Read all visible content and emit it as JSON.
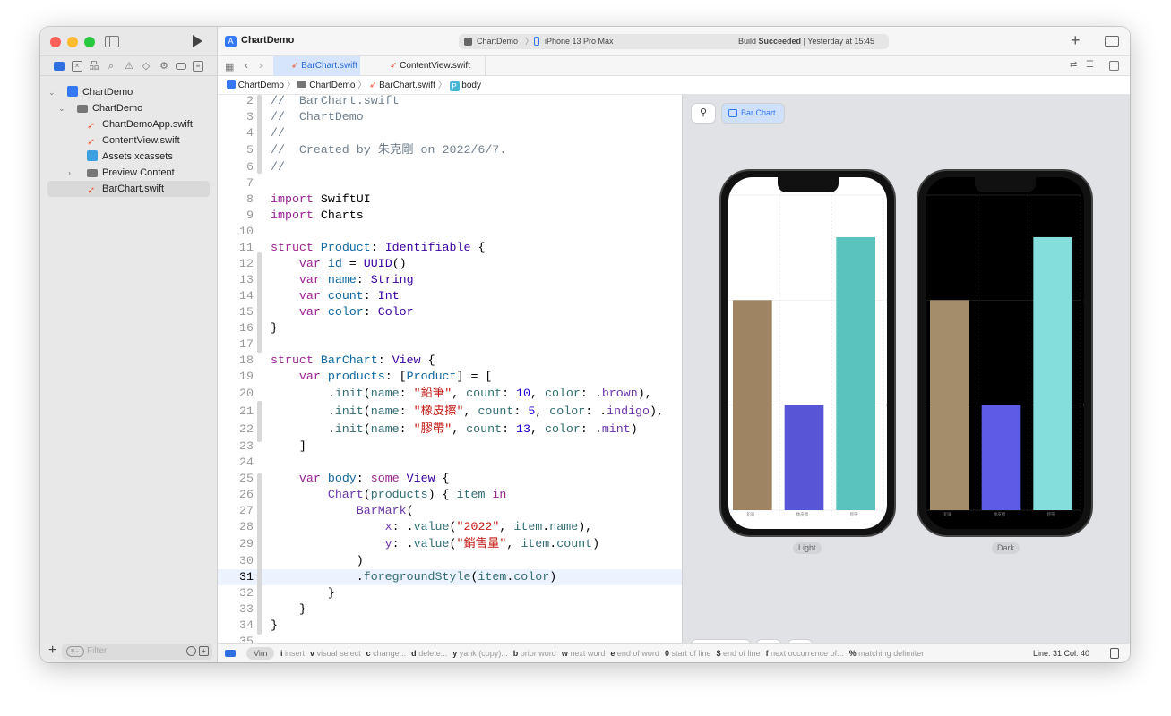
{
  "window": {
    "project": "ChartDemo",
    "scheme": "ChartDemo",
    "device": "iPhone 13 Pro Max",
    "build_status_prefix": "Build",
    "build_status": "Succeeded",
    "build_time": "| Yesterday at 15:45"
  },
  "navigator": {
    "items": [
      {
        "label": "ChartDemo",
        "kind": "project",
        "icon": "app-project-icon"
      },
      {
        "label": "ChartDemo",
        "kind": "folder",
        "icon": "folder-icon"
      },
      {
        "label": "ChartDemoApp.swift",
        "kind": "swift",
        "icon": "swift-icon"
      },
      {
        "label": "ContentView.swift",
        "kind": "swift",
        "icon": "swift-icon"
      },
      {
        "label": "Assets.xcassets",
        "kind": "assets",
        "icon": "assets-icon"
      },
      {
        "label": "Preview Content",
        "kind": "folder",
        "icon": "folder-icon"
      },
      {
        "label": "BarChart.swift",
        "kind": "swift",
        "icon": "swift-icon",
        "selected": true
      }
    ],
    "filter_placeholder": "Filter"
  },
  "tabs": [
    {
      "label": "BarChart.swift",
      "active": true
    },
    {
      "label": "ContentView.swift",
      "active": false
    }
  ],
  "breadcrumb": [
    "ChartDemo",
    "ChartDemo",
    "BarChart.swift",
    "body"
  ],
  "editor": {
    "current_line": 31,
    "lines": [
      {
        "n": 2,
        "t": [
          [
            "cm",
            "//  BarChart.swift"
          ]
        ]
      },
      {
        "n": 3,
        "t": [
          [
            "cm",
            "//  ChartDemo"
          ]
        ]
      },
      {
        "n": 4,
        "t": [
          [
            "cm",
            "//"
          ]
        ]
      },
      {
        "n": 5,
        "t": [
          [
            "cm",
            "//  Created by 朱克剛 on 2022/6/7."
          ]
        ]
      },
      {
        "n": 6,
        "t": [
          [
            "cm",
            "//"
          ]
        ]
      },
      {
        "n": 7,
        "t": []
      },
      {
        "n": 8,
        "t": [
          [
            "kw",
            "import"
          ],
          [
            "pl",
            " SwiftUI"
          ]
        ]
      },
      {
        "n": 9,
        "t": [
          [
            "kw",
            "import"
          ],
          [
            "pl",
            " Charts"
          ]
        ]
      },
      {
        "n": 10,
        "t": []
      },
      {
        "n": 11,
        "t": [
          [
            "kw",
            "struct"
          ],
          [
            "pl",
            " "
          ],
          [
            "decl",
            "Product"
          ],
          [
            "pl",
            ": "
          ],
          [
            "ty",
            "Identifiable"
          ],
          [
            "pl",
            " {"
          ]
        ]
      },
      {
        "n": 12,
        "t": [
          [
            "pl",
            "    "
          ],
          [
            "kw",
            "var"
          ],
          [
            "pl",
            " "
          ],
          [
            "decl",
            "id"
          ],
          [
            "pl",
            " = "
          ],
          [
            "ty",
            "UUID"
          ],
          [
            "pl",
            "()"
          ]
        ]
      },
      {
        "n": 13,
        "t": [
          [
            "pl",
            "    "
          ],
          [
            "kw",
            "var"
          ],
          [
            "pl",
            " "
          ],
          [
            "decl",
            "name"
          ],
          [
            "pl",
            ": "
          ],
          [
            "ty",
            "String"
          ]
        ]
      },
      {
        "n": 14,
        "t": [
          [
            "pl",
            "    "
          ],
          [
            "kw",
            "var"
          ],
          [
            "pl",
            " "
          ],
          [
            "decl",
            "count"
          ],
          [
            "pl",
            ": "
          ],
          [
            "ty",
            "Int"
          ]
        ]
      },
      {
        "n": 15,
        "t": [
          [
            "pl",
            "    "
          ],
          [
            "kw",
            "var"
          ],
          [
            "pl",
            " "
          ],
          [
            "decl",
            "color"
          ],
          [
            "pl",
            ": "
          ],
          [
            "ty",
            "Color"
          ]
        ]
      },
      {
        "n": 16,
        "t": [
          [
            "pl",
            "}"
          ]
        ]
      },
      {
        "n": 17,
        "t": []
      },
      {
        "n": 18,
        "t": [
          [
            "kw",
            "struct"
          ],
          [
            "pl",
            " "
          ],
          [
            "decl",
            "BarChart"
          ],
          [
            "pl",
            ": "
          ],
          [
            "ty",
            "View"
          ],
          [
            "pl",
            " {"
          ]
        ]
      },
      {
        "n": 19,
        "t": [
          [
            "pl",
            "    "
          ],
          [
            "kw",
            "var"
          ],
          [
            "pl",
            " "
          ],
          [
            "decl",
            "products"
          ],
          [
            "pl",
            ": ["
          ],
          [
            "decl",
            "Product"
          ],
          [
            "pl",
            "] = ["
          ]
        ]
      },
      {
        "n": 20,
        "t": [
          [
            "pl",
            "        ."
          ],
          [
            "prop",
            "init"
          ],
          [
            "pl",
            "("
          ],
          [
            "prop",
            "name"
          ],
          [
            "pl",
            ": "
          ],
          [
            "str",
            "\"鉛筆\""
          ],
          [
            "pl",
            ", "
          ],
          [
            "prop",
            "count"
          ],
          [
            "pl",
            ": "
          ],
          [
            "num",
            "10"
          ],
          [
            "pl",
            ", "
          ],
          [
            "prop",
            "color"
          ],
          [
            "pl",
            ": ."
          ],
          [
            "mem",
            "brown"
          ],
          [
            "pl",
            "),"
          ]
        ]
      },
      {
        "n": 21,
        "t": [
          [
            "pl",
            "        ."
          ],
          [
            "prop",
            "init"
          ],
          [
            "pl",
            "("
          ],
          [
            "prop",
            "name"
          ],
          [
            "pl",
            ": "
          ],
          [
            "str",
            "\"橡皮擦\""
          ],
          [
            "pl",
            ", "
          ],
          [
            "prop",
            "count"
          ],
          [
            "pl",
            ": "
          ],
          [
            "num",
            "5"
          ],
          [
            "pl",
            ", "
          ],
          [
            "prop",
            "color"
          ],
          [
            "pl",
            ": ."
          ],
          [
            "mem",
            "indigo"
          ],
          [
            "pl",
            "),"
          ]
        ]
      },
      {
        "n": 22,
        "t": [
          [
            "pl",
            "        ."
          ],
          [
            "prop",
            "init"
          ],
          [
            "pl",
            "("
          ],
          [
            "prop",
            "name"
          ],
          [
            "pl",
            ": "
          ],
          [
            "str",
            "\"膠帶\""
          ],
          [
            "pl",
            ", "
          ],
          [
            "prop",
            "count"
          ],
          [
            "pl",
            ": "
          ],
          [
            "num",
            "13"
          ],
          [
            "pl",
            ", "
          ],
          [
            "prop",
            "color"
          ],
          [
            "pl",
            ": ."
          ],
          [
            "mem",
            "mint"
          ],
          [
            "pl",
            ")"
          ]
        ]
      },
      {
        "n": 23,
        "t": [
          [
            "pl",
            "    ]"
          ]
        ]
      },
      {
        "n": 24,
        "t": []
      },
      {
        "n": 25,
        "t": [
          [
            "pl",
            "    "
          ],
          [
            "kw",
            "var"
          ],
          [
            "pl",
            " "
          ],
          [
            "decl",
            "body"
          ],
          [
            "pl",
            ": "
          ],
          [
            "kw",
            "some"
          ],
          [
            "pl",
            " "
          ],
          [
            "ty",
            "View"
          ],
          [
            "pl",
            " {"
          ]
        ]
      },
      {
        "n": 26,
        "t": [
          [
            "pl",
            "        "
          ],
          [
            "call",
            "Chart"
          ],
          [
            "pl",
            "("
          ],
          [
            "prop",
            "products"
          ],
          [
            "pl",
            ") { "
          ],
          [
            "prop",
            "item"
          ],
          [
            "pl",
            " "
          ],
          [
            "kw",
            "in"
          ]
        ]
      },
      {
        "n": 27,
        "t": [
          [
            "pl",
            "            "
          ],
          [
            "call",
            "BarMark"
          ],
          [
            "pl",
            "("
          ]
        ]
      },
      {
        "n": 28,
        "t": [
          [
            "pl",
            "                "
          ],
          [
            "call",
            "x"
          ],
          [
            "pl",
            ": ."
          ],
          [
            "prop",
            "value"
          ],
          [
            "pl",
            "("
          ],
          [
            "str",
            "\"2022\""
          ],
          [
            "pl",
            ", "
          ],
          [
            "prop",
            "item"
          ],
          [
            "pl",
            "."
          ],
          [
            "prop",
            "name"
          ],
          [
            "pl",
            "),"
          ]
        ]
      },
      {
        "n": 29,
        "t": [
          [
            "pl",
            "                "
          ],
          [
            "call",
            "y"
          ],
          [
            "pl",
            ": ."
          ],
          [
            "prop",
            "value"
          ],
          [
            "pl",
            "("
          ],
          [
            "str",
            "\"銷售量\""
          ],
          [
            "pl",
            ", "
          ],
          [
            "prop",
            "item"
          ],
          [
            "pl",
            "."
          ],
          [
            "prop",
            "count"
          ],
          [
            "pl",
            ")"
          ]
        ]
      },
      {
        "n": 30,
        "t": [
          [
            "pl",
            "            )"
          ]
        ]
      },
      {
        "n": 31,
        "t": [
          [
            "pl",
            "            ."
          ],
          [
            "prop",
            "foregroundStyle"
          ],
          [
            "pl",
            "("
          ],
          [
            "prop",
            "item"
          ],
          [
            "pl",
            "."
          ],
          [
            "prop",
            "color"
          ],
          [
            "pl",
            ")"
          ]
        ]
      },
      {
        "n": 32,
        "t": [
          [
            "pl",
            "        }"
          ]
        ]
      },
      {
        "n": 33,
        "t": [
          [
            "pl",
            "    }"
          ]
        ]
      },
      {
        "n": 34,
        "t": [
          [
            "pl",
            "}"
          ]
        ]
      },
      {
        "n": 35,
        "t": []
      }
    ]
  },
  "preview": {
    "pin_icon": "pin-icon",
    "selector_label": "Bar Chart",
    "variants": [
      {
        "label": "Light",
        "bg": "#ffffff",
        "grid": "#e6e6e6",
        "text": "#888888"
      },
      {
        "label": "Dark",
        "bg": "#000000",
        "grid": "#2a2a2a",
        "text": "#777777"
      }
    ]
  },
  "chart_data": {
    "type": "bar",
    "categories": [
      "鉛筆",
      "橡皮擦",
      "膠帶"
    ],
    "values": [
      10,
      5,
      13
    ],
    "colors_light": [
      "#9e8463",
      "#5856d6",
      "#5ac3be"
    ],
    "colors_dark": [
      "#a48d6a",
      "#5e5ce6",
      "#84dfdc"
    ],
    "yticks": [
      0,
      5,
      10,
      15
    ],
    "ylim": [
      0,
      15
    ],
    "y_axis_position": "right",
    "grid": true
  },
  "statusbar": {
    "mode": "Vim",
    "hints": [
      [
        "i",
        "insert"
      ],
      [
        "v",
        "visual select"
      ],
      [
        "c",
        "change..."
      ],
      [
        "d",
        "delete..."
      ],
      [
        "y",
        "yank (copy)..."
      ],
      [
        "b",
        "prior word"
      ],
      [
        "w",
        "next word"
      ],
      [
        "e",
        "end of word"
      ],
      [
        "0",
        "start of line"
      ],
      [
        "$",
        "end of line"
      ],
      [
        "f",
        "next occurrence of..."
      ],
      [
        "%",
        "matching delimiter"
      ]
    ],
    "position": "Line: 31  Col: 40"
  }
}
